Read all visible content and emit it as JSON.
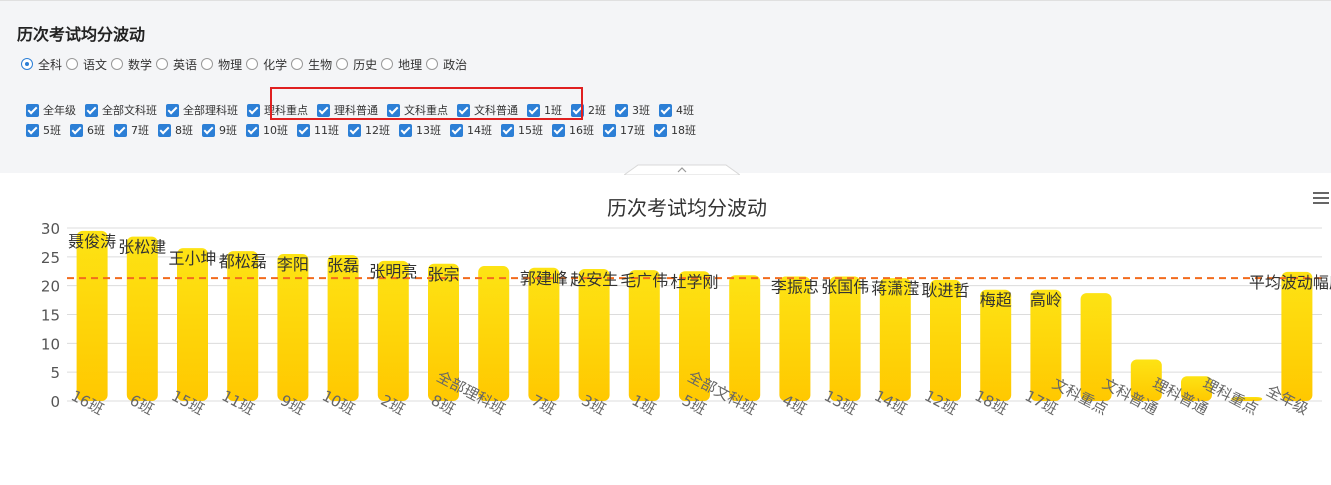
{
  "page": {
    "title": "历次考试均分波动"
  },
  "subjects": {
    "selected": "全科",
    "options": [
      "全科",
      "语文",
      "数学",
      "英语",
      "物理",
      "化学",
      "生物",
      "历史",
      "地理",
      "政治"
    ]
  },
  "class_filters": {
    "row1": [
      "全年级",
      "全部文科班",
      "全部理科班",
      "理科重点",
      "理科普通",
      "文科重点",
      "文科普通",
      "1班",
      "2班",
      "3班",
      "4班"
    ],
    "row2": [
      "5班",
      "6班",
      "7班",
      "8班",
      "9班",
      "10班",
      "11班",
      "12班",
      "13班",
      "14班",
      "15班",
      "16班",
      "17班",
      "18班"
    ],
    "all_checked": true
  },
  "icons": {
    "menu": "hamburger-menu-icon",
    "collapse": "chevron-up-icon"
  },
  "colors": {
    "bar_top": "#fde314",
    "bar_bottom": "#ffc800",
    "avg_line": "#f26b1d",
    "checkbox": "#2c7fd6",
    "highlight": "#e02020"
  },
  "chart_data": {
    "type": "bar",
    "title": "历次考试均分波动",
    "categories": [
      "16班",
      "6班",
      "15班",
      "11班",
      "9班",
      "10班",
      "2班",
      "8班",
      "全部理科班",
      "7班",
      "3班",
      "1班",
      "5班",
      "全部文科班",
      "4班",
      "13班",
      "14班",
      "12班",
      "18班",
      "17班",
      "文科重点",
      "文科普通",
      "理科普通",
      "理科重点",
      "全年级"
    ],
    "values": [
      29.5,
      28.5,
      26.5,
      26.0,
      25.5,
      25.3,
      24.3,
      23.8,
      23.4,
      23.1,
      22.9,
      22.7,
      22.5,
      21.8,
      21.6,
      21.6,
      21.3,
      21.0,
      19.3,
      19.3,
      18.7,
      7.2,
      4.3,
      0.7,
      22.4
    ],
    "bar_labels": [
      "聂俊涛",
      "张松建",
      "王小坤",
      "都松磊",
      "李阳",
      "张磊",
      "张明亮",
      "张宗",
      "",
      "郭建峰",
      "赵安生",
      "毛广伟",
      "杜学刚",
      "",
      "李振忠",
      "张国伟",
      "蒋潇滢",
      "耿进哲",
      "梅超",
      "高岭",
      "",
      "",
      "",
      "",
      "平均波动幅度"
    ],
    "ylim": [
      0,
      30
    ],
    "yticks": [
      0,
      5,
      10,
      15,
      20,
      25,
      30
    ],
    "average_line": 21.3,
    "grid": true,
    "xlabel": "",
    "ylabel": ""
  }
}
